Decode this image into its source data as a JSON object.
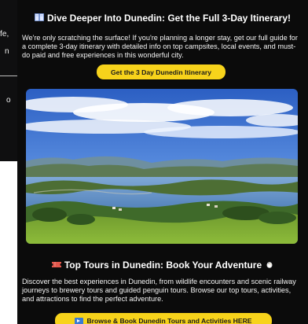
{
  "sidebar": {
    "fragments": [
      "fe,",
      "n",
      "o"
    ]
  },
  "itinerary": {
    "icon": "book-icon",
    "title": "Dive Deeper Into Dunedin: Get the Full 3-Day Itinerary!",
    "body": "We're only scratching the surface! If you're planning a longer stay, get our full guide for a complete 3-day itinerary with detailed info on top campsites, local events, and must-do paid and free experiences in this wonderful city.",
    "cta_label": "Get the 3 Day Dunedin Itinerary"
  },
  "photo": {
    "subject": "dunedin-harbour-landscape"
  },
  "tours": {
    "icon": "ticket-icon",
    "title": "Top Tours in Dunedin: Book Your Adventure",
    "trailing_icon": "penguin-icon",
    "body": "Discover the best experiences in Dunedin, from wildlife encounters and scenic railway journeys to brewery tours and guided penguin tours. Browse our top tours, activities, and attractions to find the perfect adventure.",
    "cta_icon": "play-icon",
    "cta_label": "Browse & Book Dunedin Tours and Activities HERE"
  },
  "colors": {
    "panel_bg": "#0b0b0b",
    "cta_bg": "#f7d31b",
    "text": "#ffffff"
  }
}
